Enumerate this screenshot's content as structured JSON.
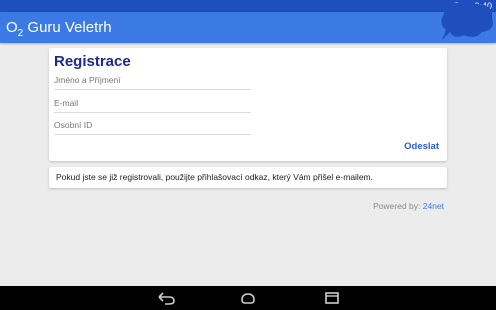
{
  "status_bar": {
    "time": "0:40"
  },
  "app_bar": {
    "title_main": "O",
    "title_sub": "2",
    "title_rest": " Guru Veletrh"
  },
  "registration": {
    "title": "Registrace",
    "fields": [
      {
        "placeholder": "Jméno a Příjmení",
        "value": ""
      },
      {
        "placeholder": "E-mail",
        "value": ""
      },
      {
        "placeholder": "Osobní ID",
        "value": ""
      }
    ],
    "submit_label": "Odeslat"
  },
  "info": {
    "text": "Pokud jste se již registrovali, použijte přihlašovací odkaz, který Vám přišel e-mailem."
  },
  "footer": {
    "powered_label": "Powered by: ",
    "powered_link": "24net"
  },
  "colors": {
    "status_bar": "#1f4fbf",
    "app_bar": "#3b7ae4",
    "title": "#1c2b8a",
    "link": "#2a5bd6",
    "background": "#ececec"
  },
  "icons": [
    "wifi-icon",
    "battery-icon",
    "chat-bubble-icon",
    "back-icon",
    "home-icon",
    "recents-icon"
  ]
}
